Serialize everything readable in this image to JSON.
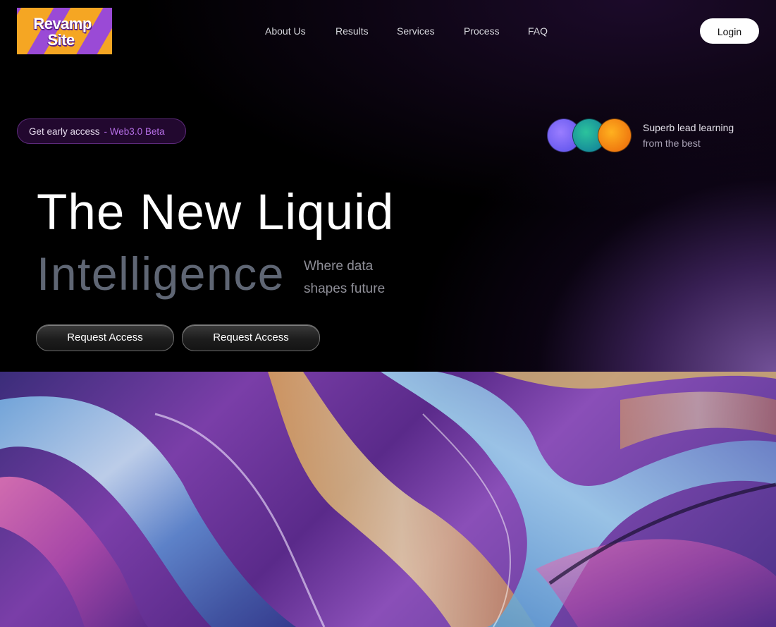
{
  "logo": {
    "line1": "Revamp",
    "line2": "Site"
  },
  "nav": {
    "items": [
      {
        "label": "About Us"
      },
      {
        "label": "Results"
      },
      {
        "label": "Services"
      },
      {
        "label": "Process"
      },
      {
        "label": "FAQ"
      }
    ],
    "login_label": "Login"
  },
  "announcement": {
    "text": "Get early access",
    "highlight": "- Web3.0 Beta"
  },
  "social_proof": {
    "line1": "Superb lead learning",
    "line2": "from the best"
  },
  "hero": {
    "title_line1": "The New Liquid",
    "title_line2": "Intelligence",
    "tagline_line1": "Where data",
    "tagline_line2": "shapes future"
  },
  "cta": [
    {
      "label": "Request Access"
    },
    {
      "label": "Request Access"
    }
  ],
  "colors": {
    "accent": "#b56ee6",
    "logo_bg": "#9a4ad6",
    "logo_stripe": "#f5a623"
  }
}
